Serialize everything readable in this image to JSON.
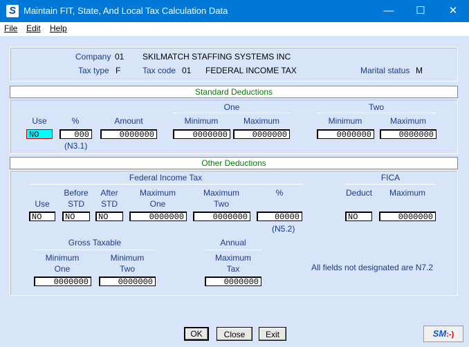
{
  "window": {
    "title": "Maintain FIT, State, And Local Tax Calculation Data",
    "app_icon_letter": "S",
    "minimize_glyph": "—",
    "maximize_glyph": "☐",
    "close_glyph": "✕"
  },
  "menu": {
    "file": "File",
    "edit": "Edit",
    "help": "Help"
  },
  "info": {
    "company_label": "Company",
    "company_code": "01",
    "company_name": "SKILMATCH STAFFING SYSTEMS INC",
    "taxtype_label": "Tax type",
    "taxtype_value": "F",
    "taxcode_label": "Tax code",
    "taxcode_value": "01",
    "taxcode_name": "FEDERAL INCOME TAX",
    "marital_label": "Marital status",
    "marital_value": "M"
  },
  "standard": {
    "header": "Standard Deductions",
    "one_label": "One",
    "two_label": "Two",
    "use_label": "Use",
    "pct_label": "%",
    "amount_label": "Amount",
    "min_label": "Minimum",
    "max_label": "Maximum",
    "use_value": "NO",
    "pct_value": "000",
    "pct_fmt": "(N3.1)",
    "amount_value": "0000000",
    "one_min": "0000000",
    "one_max": "0000000",
    "two_min": "0000000",
    "two_max": "0000000"
  },
  "other": {
    "header": "Other Deductions",
    "fit_label": "Federal Income Tax",
    "fica_label": "FICA",
    "use_label": "Use",
    "before_label": "Before",
    "after_label": "After",
    "std_label": "STD",
    "maximum_label": "Maximum",
    "one_label": "One",
    "two_label": "Two",
    "pct_label": "%",
    "deduct_label": "Deduct",
    "use_value": "NO",
    "before_value": "NO",
    "after_value": "NO",
    "max_one_value": "0000000",
    "max_two_value": "0000000",
    "pct_value": "00000",
    "pct_fmt": "(N5.2)",
    "fica_deduct_value": "NO",
    "fica_max_value": "0000000",
    "gross_label": "Gross Taxable",
    "minimum_label": "Minimum",
    "gross_min_one": "0000000",
    "gross_min_two": "0000000",
    "annual_label": "Annual",
    "tax_label": "Tax",
    "annual_max_tax": "0000000",
    "note": "All fields not designated are N7.2"
  },
  "buttons": {
    "ok": "OK",
    "close": "Close",
    "exit": "Exit"
  },
  "logo": {
    "sm": "SM",
    "face": ":-)"
  }
}
